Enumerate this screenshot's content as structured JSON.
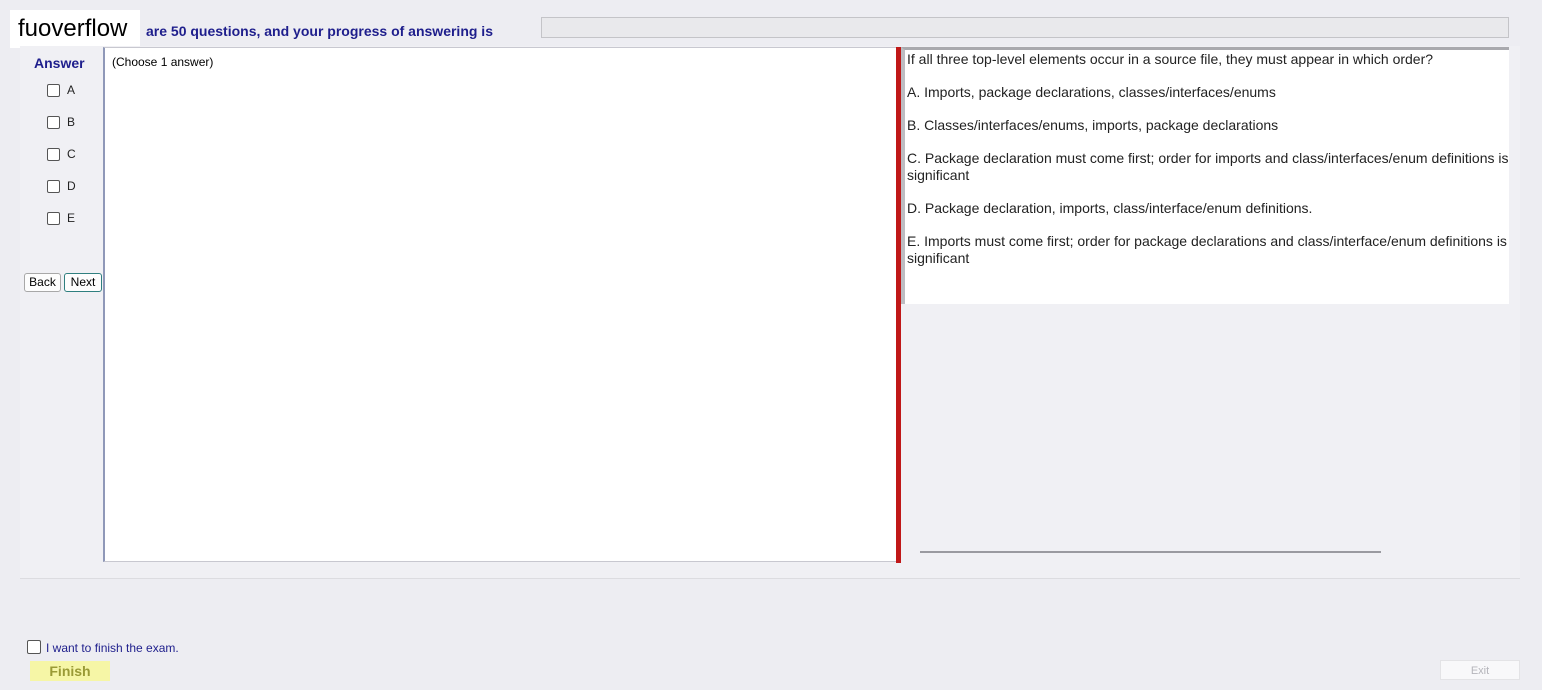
{
  "header": {
    "logo_text": "fuoverflow",
    "progress_text": "are 50 questions, and your progress of answering is",
    "progress_value": 0
  },
  "answer": {
    "heading": "Answer",
    "options": [
      "A",
      "B",
      "C",
      "D",
      "E"
    ],
    "choose_text": "(Choose 1 answer)"
  },
  "nav": {
    "back_label": "Back",
    "next_label": "Next"
  },
  "question": {
    "text": "If all three top-level elements occur in a source file, they must appear in which order?",
    "options": [
      "A.  Imports, package declarations, classes/interfaces/enums",
      "B.  Classes/interfaces/enums, imports, package declarations",
      "C.  Package declaration must come first; order for imports and class/interfaces/enum definitions is not",
      "significant",
      "D.  Package declaration, imports, class/interface/enum definitions.",
      "E.  Imports must come first; order for package declarations and class/interface/enum definitions is not",
      "significant"
    ]
  },
  "footer": {
    "finish_checkbox_label": "I want to finish the exam.",
    "finish_label": "Finish",
    "exit_label": "Exit"
  },
  "colors": {
    "accent_blue": "#1e1e8c",
    "splitter_red": "#c01818",
    "finish_yellow": "#f6f6a6"
  }
}
